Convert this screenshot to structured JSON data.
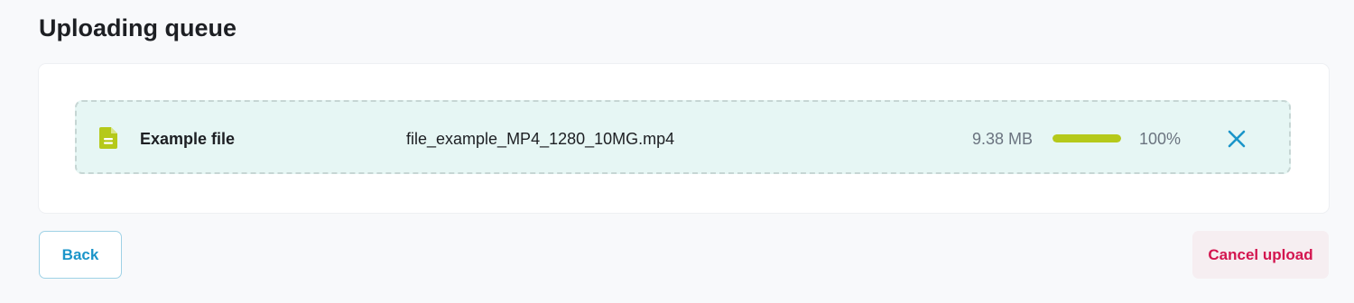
{
  "page": {
    "title": "Uploading queue"
  },
  "queue": {
    "items": [
      {
        "name": "Example file",
        "filename": "file_example_MP4_1280_10MG.mp4",
        "size": "9.38 MB",
        "progress_fraction": 1.0,
        "progress_label": "100%",
        "icon": "document-icon",
        "remove_icon": "close-icon"
      }
    ]
  },
  "actions": {
    "back_label": "Back",
    "cancel_label": "Cancel upload"
  },
  "colors": {
    "background": "#f8f9fb",
    "row_background": "#e6f6f4",
    "accent_lime": "#b5c91a",
    "accent_blue": "#1b95c9",
    "danger": "#d3154f"
  }
}
